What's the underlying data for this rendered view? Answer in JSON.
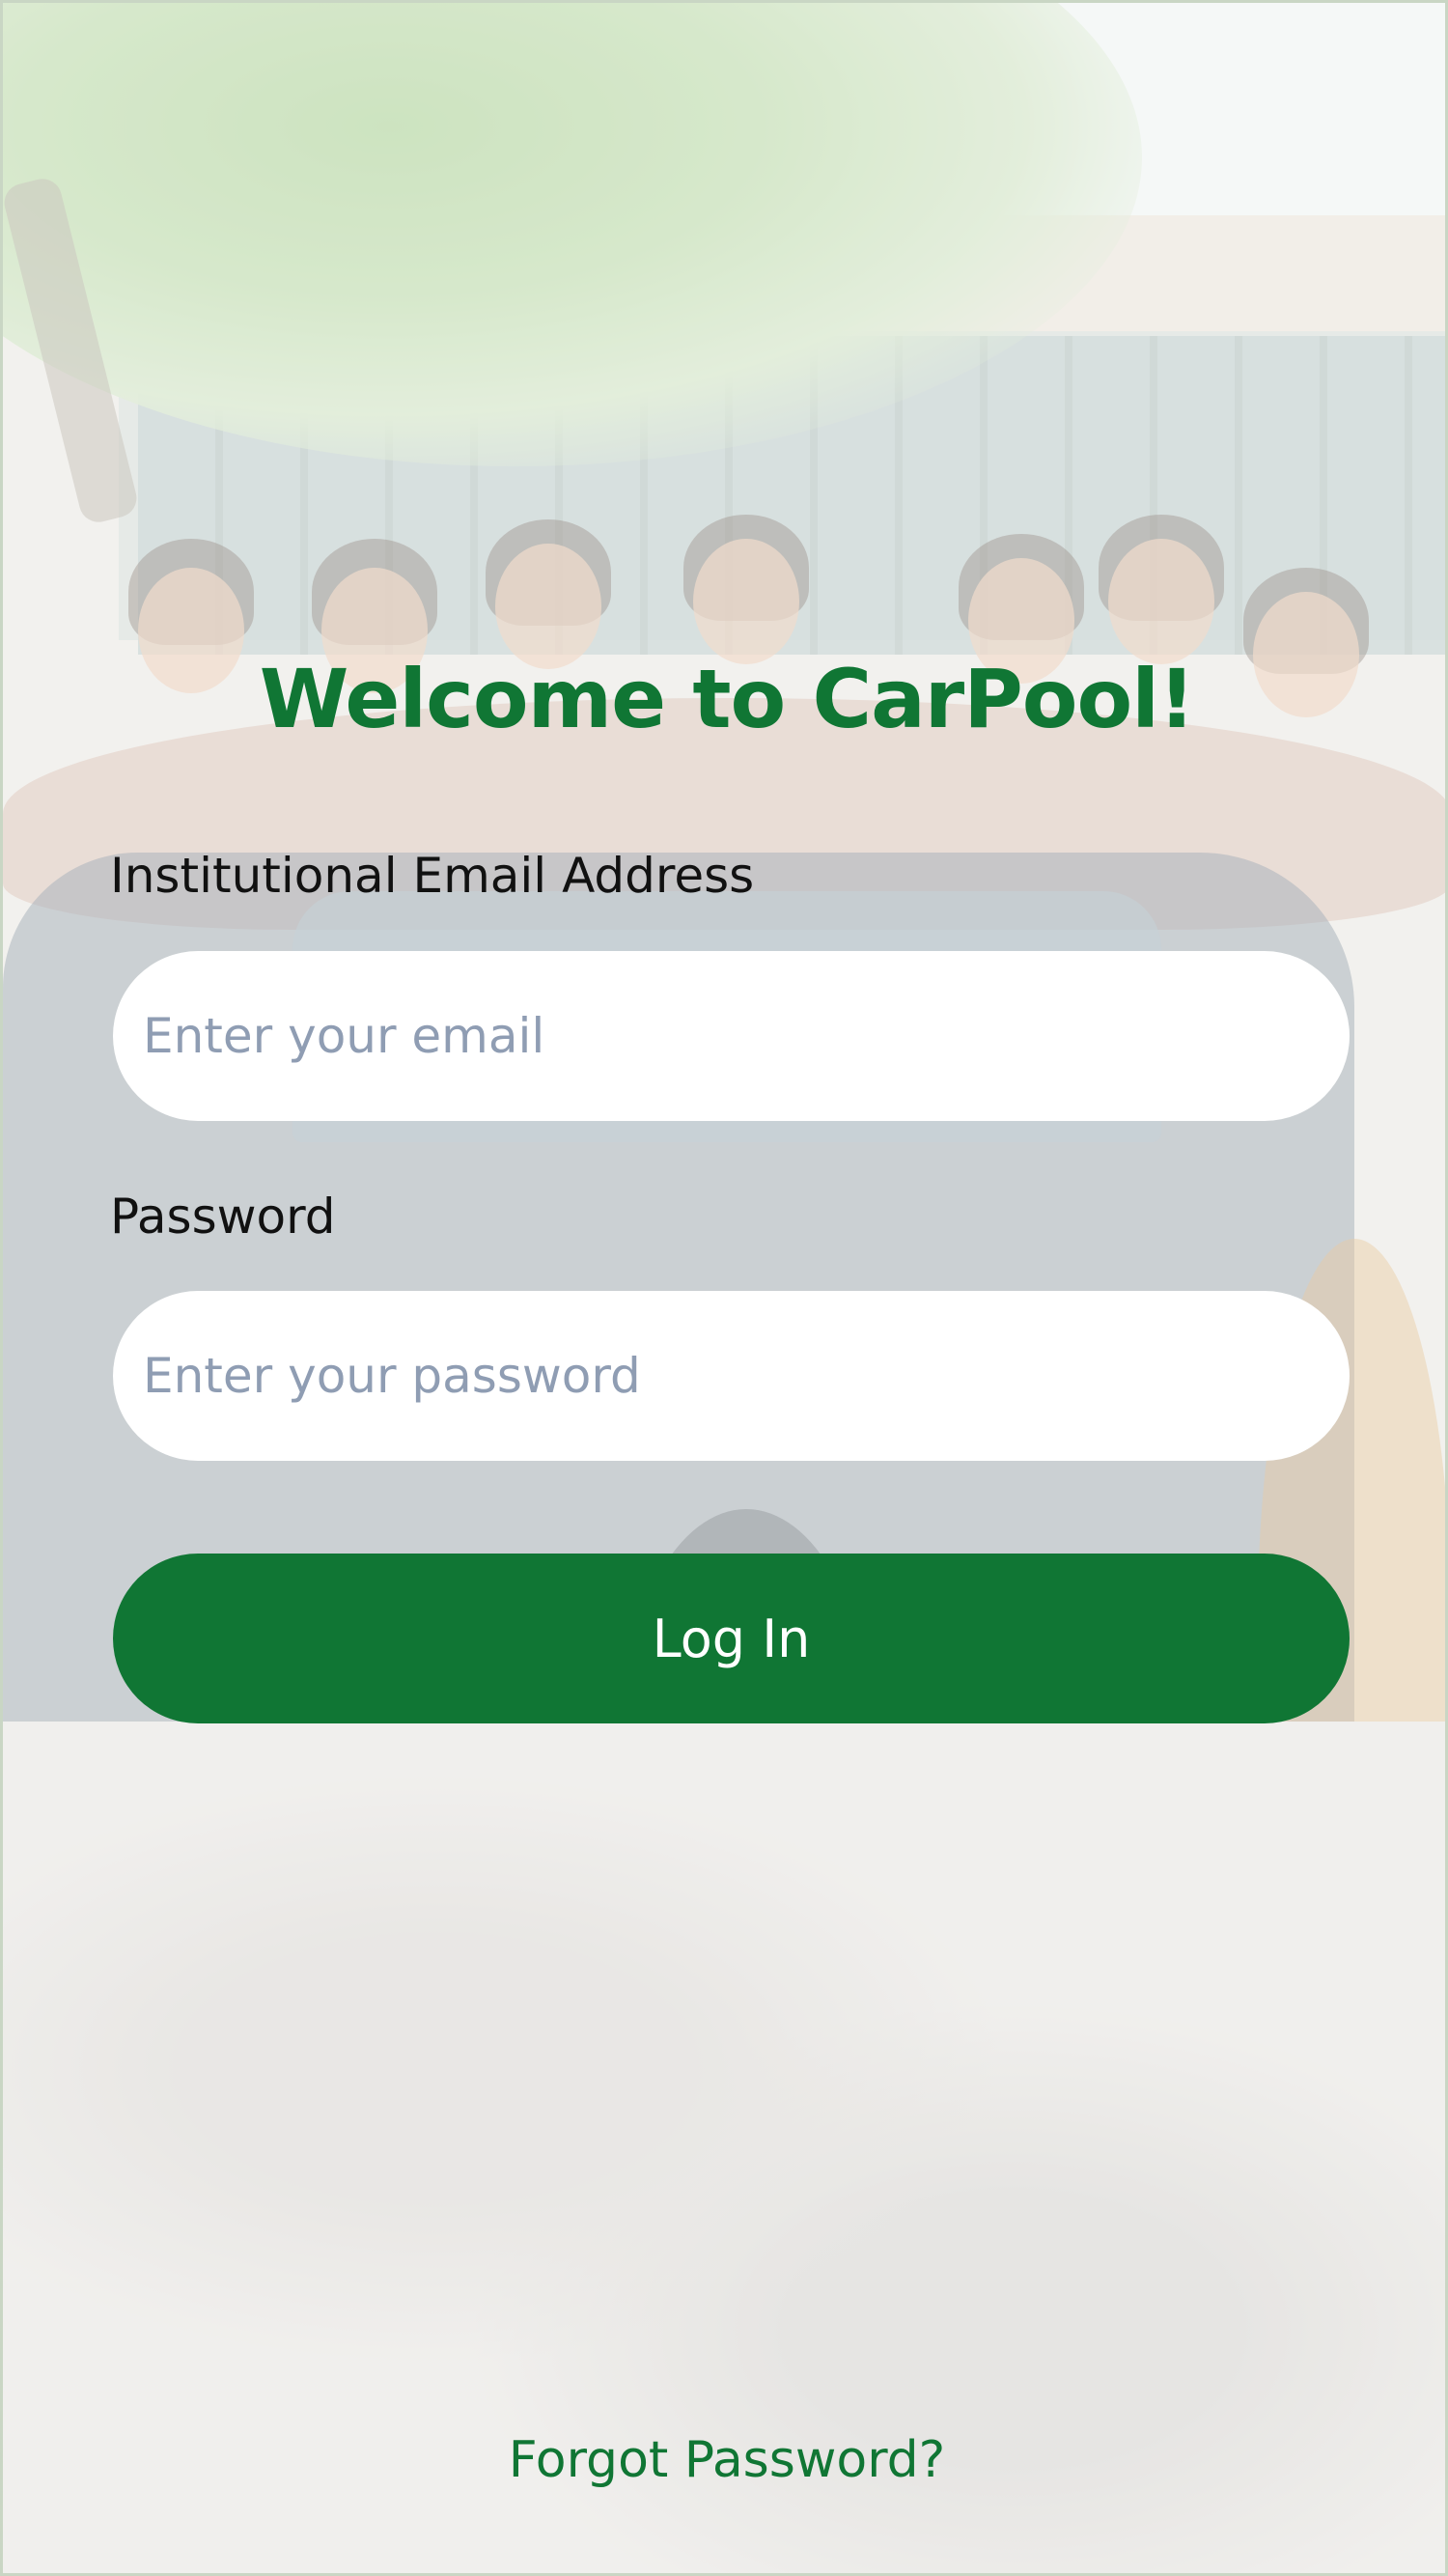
{
  "app": {
    "title": "Welcome to CarPool!",
    "accent_color": "#107634"
  },
  "form": {
    "email_label": "Institutional Email Address",
    "email_placeholder": "Enter your email",
    "email_value": "",
    "password_label": "Password",
    "password_placeholder": "Enter your password",
    "password_value": "",
    "login_label": "Log In",
    "forgot_label": "Forgot Password?"
  },
  "background": {
    "description_icon": "campus-carpool-illustration"
  }
}
